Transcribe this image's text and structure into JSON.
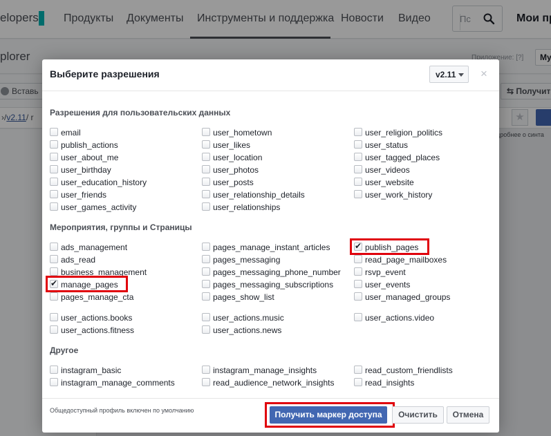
{
  "topnav": {
    "brand": "elopers",
    "items": [
      "Продукты",
      "Документы",
      "Инструменты и поддержка",
      "Новости",
      "Видео"
    ],
    "search_placeholder": "Пс",
    "myapps": "Мои пр"
  },
  "subbar": {
    "title": "plorer",
    "app_label": "Приложение:",
    "help": "[?]",
    "app_value": "Му"
  },
  "toolbar": {
    "left_btn": "Вставь",
    "right_btn": "Получит"
  },
  "pathbar": {
    "prefix": "›/",
    "version": "v2.11",
    "suffix": "/ r",
    "hint": "дробнее о синта"
  },
  "modal": {
    "title": "Выберите разрешения",
    "version": "v2.11",
    "close": "×",
    "sections": [
      {
        "title": "Разрешения для пользовательских данных",
        "columns": [
          [
            {
              "label": "email",
              "checked": false
            },
            {
              "label": "publish_actions",
              "checked": false
            },
            {
              "label": "user_about_me",
              "checked": false
            },
            {
              "label": "user_birthday",
              "checked": false
            },
            {
              "label": "user_education_history",
              "checked": false
            },
            {
              "label": "user_friends",
              "checked": false
            },
            {
              "label": "user_games_activity",
              "checked": false
            }
          ],
          [
            {
              "label": "user_hometown",
              "checked": false
            },
            {
              "label": "user_likes",
              "checked": false
            },
            {
              "label": "user_location",
              "checked": false
            },
            {
              "label": "user_photos",
              "checked": false
            },
            {
              "label": "user_posts",
              "checked": false
            },
            {
              "label": "user_relationship_details",
              "checked": false
            },
            {
              "label": "user_relationships",
              "checked": false
            }
          ],
          [
            {
              "label": "user_religion_politics",
              "checked": false
            },
            {
              "label": "user_status",
              "checked": false
            },
            {
              "label": "user_tagged_places",
              "checked": false
            },
            {
              "label": "user_videos",
              "checked": false
            },
            {
              "label": "user_website",
              "checked": false
            },
            {
              "label": "user_work_history",
              "checked": false
            }
          ]
        ]
      },
      {
        "title": "Мероприятия, группы и Страницы",
        "columns": [
          [
            {
              "label": "ads_management",
              "checked": false
            },
            {
              "label": "ads_read",
              "checked": false
            },
            {
              "label": "business_management",
              "checked": false
            },
            {
              "label": "manage_pages",
              "checked": true
            },
            {
              "label": "pages_manage_cta",
              "checked": false
            }
          ],
          [
            {
              "label": "pages_manage_instant_articles",
              "checked": false
            },
            {
              "label": "pages_messaging",
              "checked": false
            },
            {
              "label": "pages_messaging_phone_number",
              "checked": false
            },
            {
              "label": "pages_messaging_subscriptions",
              "checked": false
            },
            {
              "label": "pages_show_list",
              "checked": false
            }
          ],
          [
            {
              "label": "publish_pages",
              "checked": true
            },
            {
              "label": "read_page_mailboxes",
              "checked": false
            },
            {
              "label": "rsvp_event",
              "checked": false
            },
            {
              "label": "user_events",
              "checked": false
            },
            {
              "label": "user_managed_groups",
              "checked": false
            }
          ]
        ],
        "extra": [
          [
            {
              "label": "user_actions.books",
              "checked": false
            },
            {
              "label": "user_actions.fitness",
              "checked": false
            }
          ],
          [
            {
              "label": "user_actions.music",
              "checked": false
            },
            {
              "label": "user_actions.news",
              "checked": false
            }
          ],
          [
            {
              "label": "user_actions.video",
              "checked": false
            }
          ]
        ]
      },
      {
        "title": "Другое",
        "columns": [
          [
            {
              "label": "instagram_basic",
              "checked": false
            },
            {
              "label": "instagram_manage_comments",
              "checked": false
            }
          ],
          [
            {
              "label": "instagram_manage_insights",
              "checked": false
            },
            {
              "label": "read_audience_network_insights",
              "checked": false
            }
          ],
          [
            {
              "label": "read_custom_friendlists",
              "checked": false
            },
            {
              "label": "read_insights",
              "checked": false
            }
          ]
        ]
      }
    ],
    "footer_note": "Общедоступный профиль включен по умолчанию",
    "buttons": {
      "get_token": "Получить маркер доступа",
      "clear": "Очистить",
      "cancel": "Отмена"
    }
  },
  "colors": {
    "accent": "#4267b2",
    "highlight": "#e0000c",
    "brand_bar": "#00b4b4"
  }
}
